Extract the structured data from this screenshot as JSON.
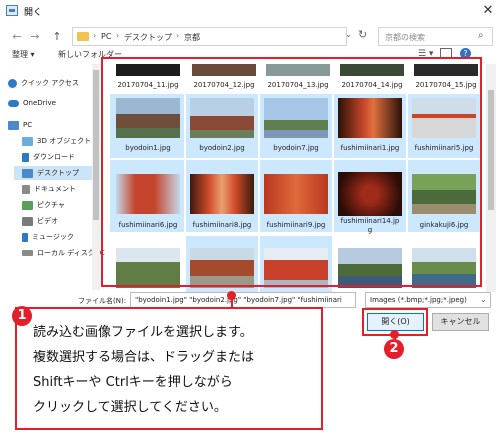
{
  "window": {
    "title": "開く"
  },
  "address": {
    "crumbs": [
      "PC",
      "デスクトップ",
      "京都"
    ],
    "separator": "›",
    "back_icon": "←",
    "forward_icon": "→",
    "up_icon": "↑",
    "dropdown_icon": "⌄",
    "refresh_icon": "↻"
  },
  "search": {
    "placeholder": "京都の検索",
    "icon": "⌕"
  },
  "toolbar": {
    "organize_label": "整理 ▾",
    "new_folder_label": "新しいフォルダー",
    "view_icon": "☰ ▾",
    "help_icon": "?"
  },
  "nav": {
    "items": [
      {
        "label": "クイック アクセス",
        "icon": "star-icon",
        "color": "#2f78c4"
      },
      {
        "label": "OneDrive",
        "icon": "cloud-icon",
        "color": "#2f78c4"
      },
      {
        "label": "PC",
        "icon": "pc-icon",
        "color": "#4d88c8"
      },
      {
        "label": "3D オブジェクト",
        "icon": "cube-icon",
        "color": "#6ab0de"
      },
      {
        "label": "ダウンロード",
        "icon": "download-icon",
        "color": "#2f78c4"
      },
      {
        "label": "デスクトップ",
        "icon": "desktop-icon",
        "color": "#4d88c8"
      },
      {
        "label": "ドキュメント",
        "icon": "document-icon",
        "color": "#8a8a8a"
      },
      {
        "label": "ピクチャ",
        "icon": "picture-icon",
        "color": "#5aa05a"
      },
      {
        "label": "ビデオ",
        "icon": "video-icon",
        "color": "#7a7a7a"
      },
      {
        "label": "ミュージック",
        "icon": "music-icon",
        "color": "#2f78c4"
      },
      {
        "label": "ローカル ディスク (C",
        "icon": "disk-icon",
        "color": "#8a8a8a"
      }
    ]
  },
  "files": {
    "row0": [
      "20170704_11.jpg",
      "20170704_12.jpg",
      "20170704_13.jpg",
      "20170704_14.jpg",
      "20170704_15.jpg"
    ],
    "row1": [
      "byodoin1.jpg",
      "byodoin2.jpg",
      "byodoin7.jpg",
      "fushimiinari1.jpg",
      "fushimiinari5.jpg"
    ],
    "row2": [
      "fushimiinari6.jpg",
      "fushimiinari8.jpg",
      "fushimiinari9.jpg",
      "fushimiinari14.jp",
      "ginkakuji6.jpg"
    ],
    "row2_wrap": "g"
  },
  "bottom": {
    "filename_label": "ファイル名(N):",
    "filename_value": "\"byodoin1.jpg\" \"byodoin2.jpg\" \"byodoin7.jpg\" \"fushimiinari",
    "filetype_value": "Images (*.bmp;*.jpg;*.jpeg)",
    "filetype_arrow": "⌄",
    "open_label": "開く(O)",
    "cancel_label": "キャンセル"
  },
  "callout": {
    "badge1": "1",
    "badge2": "2",
    "lines": [
      "読み込む画像ファイルを選択します。",
      "複数選択する場合は、ドラッグまたは",
      "Shiftキーや Ctrlキーを押しながら",
      "クリックして選択してください。"
    ]
  },
  "colors": {
    "accent_red": "#e41e2b",
    "selection": "#cce8ff",
    "blue": "#0078d7"
  }
}
